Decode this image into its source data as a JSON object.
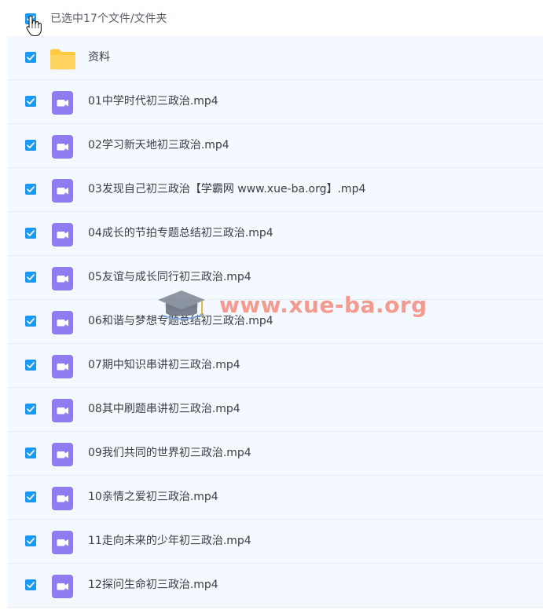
{
  "header": {
    "selection_text": "已选中17个文件/文件夹"
  },
  "files": [
    {
      "name": "资料",
      "type": "folder"
    },
    {
      "name": "01中学时代初三政治.mp4",
      "type": "video"
    },
    {
      "name": "02学习新天地初三政治.mp4",
      "type": "video"
    },
    {
      "name": "03发现自己初三政治【学霸网 www.xue-ba.org】.mp4",
      "type": "video"
    },
    {
      "name": "04成长的节拍专题总结初三政治.mp4",
      "type": "video"
    },
    {
      "name": "05友谊与成长同行初三政治.mp4",
      "type": "video"
    },
    {
      "name": "06和谐与梦想专题总结初三政治.mp4",
      "type": "video"
    },
    {
      "name": "07期中知识串讲初三政治.mp4",
      "type": "video"
    },
    {
      "name": "08其中刷题串讲初三政治.mp4",
      "type": "video"
    },
    {
      "name": "09我们共同的世界初三政治.mp4",
      "type": "video"
    },
    {
      "name": "10亲情之爱初三政治.mp4",
      "type": "video"
    },
    {
      "name": "11走向未来的少年初三政治.mp4",
      "type": "video"
    },
    {
      "name": "12探问生命初三政治.mp4",
      "type": "video"
    }
  ],
  "watermark": {
    "text": "www.xue-ba.org"
  },
  "colors": {
    "checkbox": "#1a9af5",
    "video_icon": "#8f7cf0",
    "folder_icon": "#ffc941",
    "row_bg": "#f4f9ff"
  }
}
